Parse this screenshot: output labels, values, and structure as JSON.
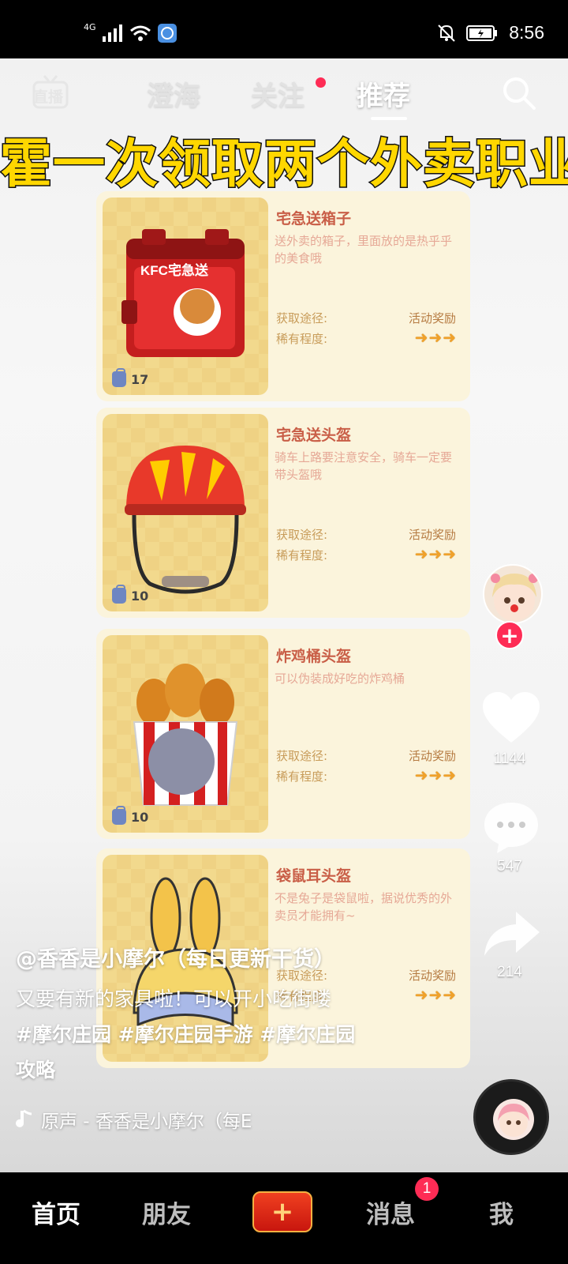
{
  "status_bar": {
    "network": "4G",
    "time": "8:56"
  },
  "top_tabs": {
    "live_label": "直播",
    "tabs": [
      "澄海",
      "关注",
      "推荐"
    ],
    "active_tab": "推荐"
  },
  "overlay_title": "霍一次领取两个外卖职业",
  "items": [
    {
      "name": "宅急送箱子",
      "desc": "送外卖的箱子，里面放的是热乎乎的美食哦",
      "source_label": "获取途径:",
      "source_value": "活动奖励",
      "rarity_label": "稀有程度:",
      "count": "17",
      "box_logo": "KFC宅急送"
    },
    {
      "name": "宅急送头盔",
      "desc": "骑车上路要注意安全，骑车一定要带头盔哦",
      "source_label": "获取途径:",
      "source_value": "活动奖励",
      "rarity_label": "稀有程度:",
      "count": "10"
    },
    {
      "name": "炸鸡桶头盔",
      "desc": "可以伪装成好吃的炸鸡桶",
      "source_label": "获取途径:",
      "source_value": "活动奖励",
      "rarity_label": "稀有程度:",
      "count": "10"
    },
    {
      "name": "袋鼠耳头盔",
      "desc": "不是兔子是袋鼠啦，据说优秀的外卖员才能拥有~",
      "source_label": "获取途径:",
      "source_value": "活动奖励",
      "rarity_label": "稀有程度:",
      "count": ""
    }
  ],
  "actions": {
    "likes": "1144",
    "comments": "547",
    "shares": "214"
  },
  "caption": {
    "author": "@香香是小摩尔（每日更新干货）",
    "text": "又要有新的家具啦！可以开小吃街喽",
    "tags_line1": "#摩尔庄园 #摩尔庄园手游 #摩尔庄园",
    "tags_line2": "攻略",
    "music": "原声 - 香香是小摩尔（每E"
  },
  "bottom_nav": {
    "home": "首页",
    "friends": "朋友",
    "messages": "消息",
    "messages_badge": "1",
    "me": "我",
    "plus": "+"
  },
  "colors": {
    "accent": "#fe2c55",
    "title_yellow": "#ffd700",
    "card_bg": "#fbf4dc",
    "item_name": "#c95e47"
  }
}
